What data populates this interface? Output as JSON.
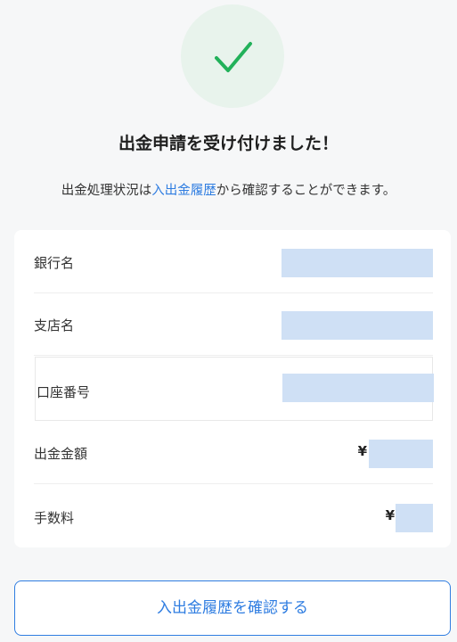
{
  "header": {
    "title": "出金申請を受け付けました！",
    "subtitle_prefix": "出金処理状況は",
    "subtitle_link": "入出金履歴",
    "subtitle_suffix": "から確認することができます。"
  },
  "details": {
    "rows": [
      {
        "label": "銀行名"
      },
      {
        "label": "支店名"
      },
      {
        "label": "口座番号"
      },
      {
        "label": "出金金額",
        "currency": "¥"
      },
      {
        "label": "手数料",
        "currency": "¥"
      }
    ]
  },
  "actions": {
    "history_button_label": "入出金履歴を確認する"
  },
  "colors": {
    "accent": "#2f7de1",
    "success": "#22b15a",
    "success_bg": "#e8f3ec",
    "redacted": "#cfe0f5"
  },
  "icons": {
    "status": "check-icon"
  }
}
